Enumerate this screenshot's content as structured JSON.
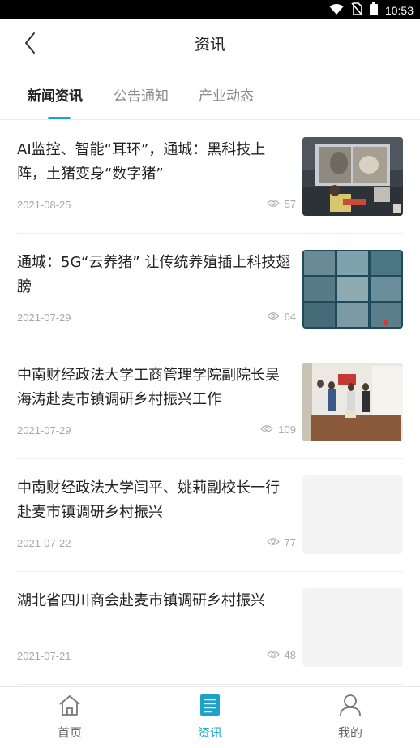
{
  "status_bar": {
    "time": "10:53",
    "icons": [
      "wifi-icon",
      "no-sim-icon",
      "battery-icon"
    ]
  },
  "header": {
    "title": "资讯",
    "back_icon": "chevron-left-icon"
  },
  "tabs": [
    {
      "label": "新闻资讯",
      "active": true
    },
    {
      "label": "公告通知",
      "active": false
    },
    {
      "label": "产业动态",
      "active": false
    }
  ],
  "news": [
    {
      "title": "AI监控、智能“耳环”，通城：黑科技上阵，土猪变身“数字猪”",
      "date": "2021-08-25",
      "views": "57",
      "thumbnail": "photo"
    },
    {
      "title": "通城：5G“云养猪” 让传统养殖插上科技翅膀",
      "date": "2021-07-29",
      "views": "64",
      "thumbnail": "photo"
    },
    {
      "title": "中南财经政法大学工商管理学院副院长吴海涛赴麦市镇调研乡村振兴工作",
      "date": "2021-07-29",
      "views": "109",
      "thumbnail": "photo"
    },
    {
      "title": "中南财经政法大学闫平、姚莉副校长一行 赴麦市镇调研乡村振兴",
      "date": "2021-07-22",
      "views": "77",
      "thumbnail": "placeholder"
    },
    {
      "title": "湖北省四川商会赴麦市镇调研乡村振兴",
      "date": "2021-07-21",
      "views": "48",
      "thumbnail": "placeholder"
    }
  ],
  "bottom_nav": [
    {
      "label": "首页",
      "icon": "home-icon",
      "active": false
    },
    {
      "label": "资讯",
      "icon": "news-icon",
      "active": true
    },
    {
      "label": "我的",
      "icon": "user-icon",
      "active": false
    }
  ],
  "colors": {
    "accent": "#1ea1c8",
    "text_primary": "#222222",
    "text_secondary": "#a8a8a8",
    "divider": "#eeeeee"
  }
}
